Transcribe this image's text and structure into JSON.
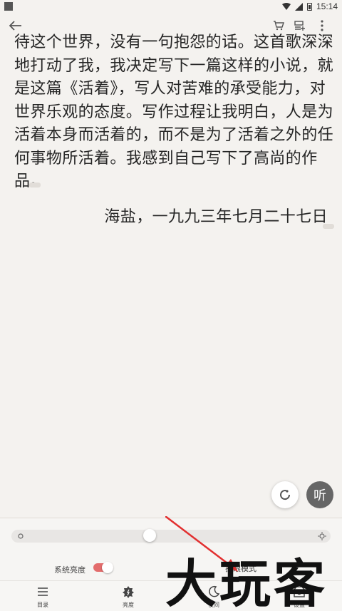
{
  "status_bar": {
    "time": "15:14"
  },
  "reader": {
    "lines": [
      "待这个世界，没有一句抱怨的话。这首歌深深",
      "地打动了我，我决定写下一篇这样的小说，就",
      "是这篇《活着》，写人对苦难的承受能力，对",
      "世界乐观的态度。写作过程让我明白，人是为",
      "活着本身而活着的，而不是为了活着之外的任",
      "何事物所活着。我感到自己写下了高尚的作",
      "品。"
    ],
    "dateline": "海盐，一九九三年七月二十七日"
  },
  "fabs": {
    "listen_label": "听"
  },
  "brightness_panel": {
    "system_brightness_label": "系统亮度",
    "system_brightness_on": true,
    "eye_mode_label": "护眼模式",
    "slider_level": 0.43
  },
  "bottom_nav": [
    {
      "label": "目录",
      "icon": "list-icon"
    },
    {
      "label": "亮度",
      "icon": "brightness-icon"
    },
    {
      "label": "夜间",
      "icon": "moon-icon"
    },
    {
      "label": "设置",
      "icon": "gear-icon"
    }
  ],
  "watermark": {
    "text": "大玩客"
  },
  "colors": {
    "toggle_on": "#e36c6c",
    "fab_listen": "#666666",
    "background": "#f4f2ef"
  }
}
